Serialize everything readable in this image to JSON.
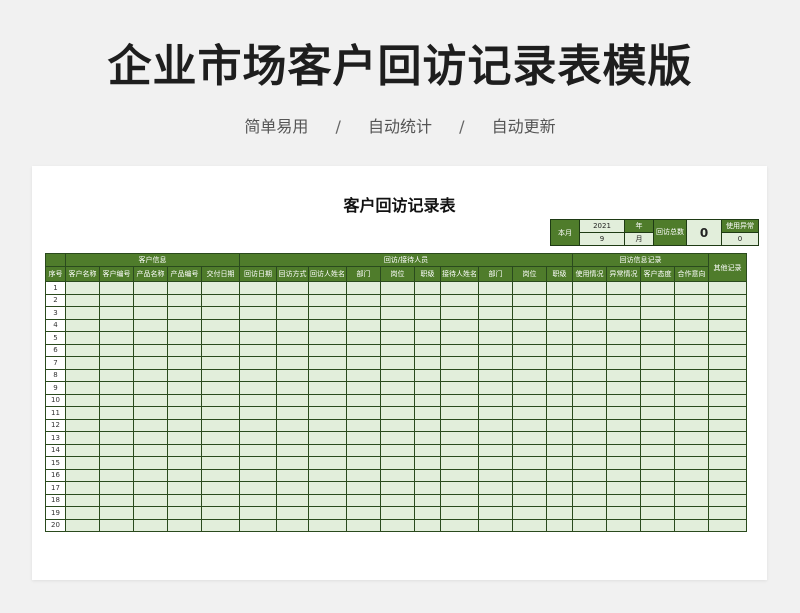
{
  "page": {
    "title": "企业市场客户回访记录表模版",
    "features": [
      "简单易用",
      "自动统计",
      "自动更新"
    ],
    "separator": "/"
  },
  "sheet": {
    "title": "客户回访记录表",
    "summary": {
      "month_label": "本月",
      "year_value": "2021",
      "year_label": "年",
      "month_value": "9",
      "month_unit": "月",
      "visit_total_label": "回访总数",
      "visit_total_value": "0",
      "abnormal_label": "使用异常",
      "abnormal_value": "0"
    },
    "groups": {
      "customer_info": "客户信息",
      "visit_people": "回访/接待人员",
      "visit_info": "回访信息记录",
      "other": "其他记录"
    },
    "columns": {
      "seq": "序号",
      "customer_name": "客户名称",
      "customer_no": "客户编号",
      "product_name": "产品名称",
      "product_no": "产品编号",
      "delivery_date": "交付日期",
      "visit_date": "回访日期",
      "visit_method": "回访方式",
      "visitor_name": "回访人姓名",
      "dept1": "部门",
      "post1": "岗位",
      "rank1": "职级",
      "receiver_name": "接待人姓名",
      "dept2": "部门",
      "post2": "岗位",
      "rank2": "职级",
      "usage": "使用情况",
      "abnormal": "异常情况",
      "attitude": "客户态度",
      "intention": "合作意向"
    },
    "row_numbers": [
      "1",
      "2",
      "3",
      "4",
      "5",
      "6",
      "7",
      "8",
      "9",
      "10",
      "11",
      "12",
      "13",
      "14",
      "15",
      "16",
      "17",
      "18",
      "19",
      "20"
    ]
  }
}
